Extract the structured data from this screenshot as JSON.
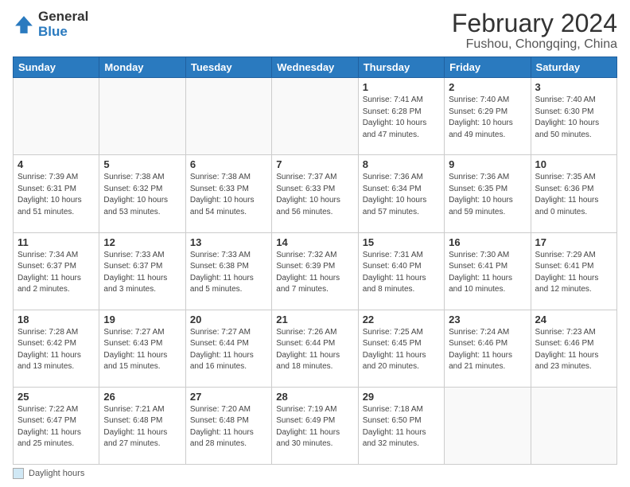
{
  "header": {
    "logo_general": "General",
    "logo_blue": "Blue",
    "month_title": "February 2024",
    "location": "Fushou, Chongqing, China"
  },
  "weekdays": [
    "Sunday",
    "Monday",
    "Tuesday",
    "Wednesday",
    "Thursday",
    "Friday",
    "Saturday"
  ],
  "weeks": [
    [
      {
        "day": "",
        "info": ""
      },
      {
        "day": "",
        "info": ""
      },
      {
        "day": "",
        "info": ""
      },
      {
        "day": "",
        "info": ""
      },
      {
        "day": "1",
        "info": "Sunrise: 7:41 AM\nSunset: 6:28 PM\nDaylight: 10 hours\nand 47 minutes."
      },
      {
        "day": "2",
        "info": "Sunrise: 7:40 AM\nSunset: 6:29 PM\nDaylight: 10 hours\nand 49 minutes."
      },
      {
        "day": "3",
        "info": "Sunrise: 7:40 AM\nSunset: 6:30 PM\nDaylight: 10 hours\nand 50 minutes."
      }
    ],
    [
      {
        "day": "4",
        "info": "Sunrise: 7:39 AM\nSunset: 6:31 PM\nDaylight: 10 hours\nand 51 minutes."
      },
      {
        "day": "5",
        "info": "Sunrise: 7:38 AM\nSunset: 6:32 PM\nDaylight: 10 hours\nand 53 minutes."
      },
      {
        "day": "6",
        "info": "Sunrise: 7:38 AM\nSunset: 6:33 PM\nDaylight: 10 hours\nand 54 minutes."
      },
      {
        "day": "7",
        "info": "Sunrise: 7:37 AM\nSunset: 6:33 PM\nDaylight: 10 hours\nand 56 minutes."
      },
      {
        "day": "8",
        "info": "Sunrise: 7:36 AM\nSunset: 6:34 PM\nDaylight: 10 hours\nand 57 minutes."
      },
      {
        "day": "9",
        "info": "Sunrise: 7:36 AM\nSunset: 6:35 PM\nDaylight: 10 hours\nand 59 minutes."
      },
      {
        "day": "10",
        "info": "Sunrise: 7:35 AM\nSunset: 6:36 PM\nDaylight: 11 hours\nand 0 minutes."
      }
    ],
    [
      {
        "day": "11",
        "info": "Sunrise: 7:34 AM\nSunset: 6:37 PM\nDaylight: 11 hours\nand 2 minutes."
      },
      {
        "day": "12",
        "info": "Sunrise: 7:33 AM\nSunset: 6:37 PM\nDaylight: 11 hours\nand 3 minutes."
      },
      {
        "day": "13",
        "info": "Sunrise: 7:33 AM\nSunset: 6:38 PM\nDaylight: 11 hours\nand 5 minutes."
      },
      {
        "day": "14",
        "info": "Sunrise: 7:32 AM\nSunset: 6:39 PM\nDaylight: 11 hours\nand 7 minutes."
      },
      {
        "day": "15",
        "info": "Sunrise: 7:31 AM\nSunset: 6:40 PM\nDaylight: 11 hours\nand 8 minutes."
      },
      {
        "day": "16",
        "info": "Sunrise: 7:30 AM\nSunset: 6:41 PM\nDaylight: 11 hours\nand 10 minutes."
      },
      {
        "day": "17",
        "info": "Sunrise: 7:29 AM\nSunset: 6:41 PM\nDaylight: 11 hours\nand 12 minutes."
      }
    ],
    [
      {
        "day": "18",
        "info": "Sunrise: 7:28 AM\nSunset: 6:42 PM\nDaylight: 11 hours\nand 13 minutes."
      },
      {
        "day": "19",
        "info": "Sunrise: 7:27 AM\nSunset: 6:43 PM\nDaylight: 11 hours\nand 15 minutes."
      },
      {
        "day": "20",
        "info": "Sunrise: 7:27 AM\nSunset: 6:44 PM\nDaylight: 11 hours\nand 16 minutes."
      },
      {
        "day": "21",
        "info": "Sunrise: 7:26 AM\nSunset: 6:44 PM\nDaylight: 11 hours\nand 18 minutes."
      },
      {
        "day": "22",
        "info": "Sunrise: 7:25 AM\nSunset: 6:45 PM\nDaylight: 11 hours\nand 20 minutes."
      },
      {
        "day": "23",
        "info": "Sunrise: 7:24 AM\nSunset: 6:46 PM\nDaylight: 11 hours\nand 21 minutes."
      },
      {
        "day": "24",
        "info": "Sunrise: 7:23 AM\nSunset: 6:46 PM\nDaylight: 11 hours\nand 23 minutes."
      }
    ],
    [
      {
        "day": "25",
        "info": "Sunrise: 7:22 AM\nSunset: 6:47 PM\nDaylight: 11 hours\nand 25 minutes."
      },
      {
        "day": "26",
        "info": "Sunrise: 7:21 AM\nSunset: 6:48 PM\nDaylight: 11 hours\nand 27 minutes."
      },
      {
        "day": "27",
        "info": "Sunrise: 7:20 AM\nSunset: 6:48 PM\nDaylight: 11 hours\nand 28 minutes."
      },
      {
        "day": "28",
        "info": "Sunrise: 7:19 AM\nSunset: 6:49 PM\nDaylight: 11 hours\nand 30 minutes."
      },
      {
        "day": "29",
        "info": "Sunrise: 7:18 AM\nSunset: 6:50 PM\nDaylight: 11 hours\nand 32 minutes."
      },
      {
        "day": "",
        "info": ""
      },
      {
        "day": "",
        "info": ""
      }
    ]
  ],
  "legend": {
    "box_label": "Daylight hours"
  }
}
